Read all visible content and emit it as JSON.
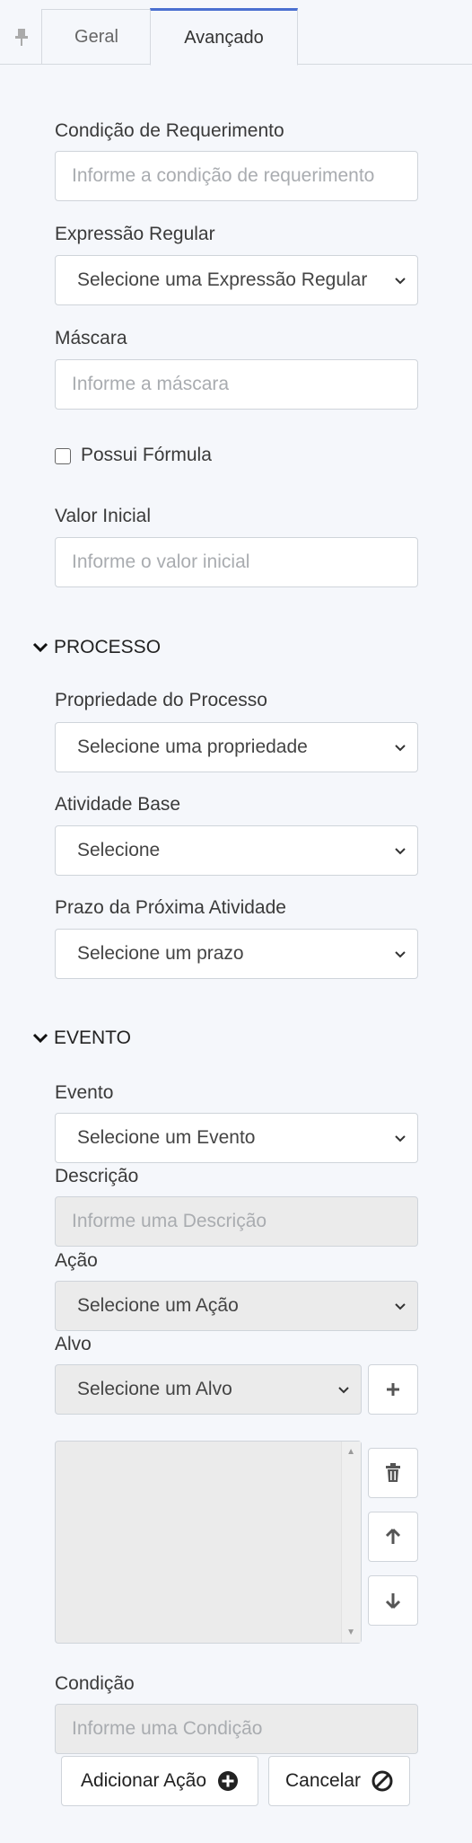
{
  "tabs": {
    "geral": "Geral",
    "avancado": "Avançado"
  },
  "fields": {
    "condicao_requerimento": {
      "label": "Condição de Requerimento",
      "placeholder": "Informe a condição de requerimento"
    },
    "expressao_regular": {
      "label": "Expressão Regular",
      "value": "Selecione uma Expressão Regular"
    },
    "mascara": {
      "label": "Máscara",
      "placeholder": "Informe a máscara"
    },
    "possui_formula": {
      "label": "Possui Fórmula",
      "checked": false
    },
    "valor_inicial": {
      "label": "Valor Inicial",
      "placeholder": "Informe o valor inicial"
    }
  },
  "processo": {
    "title": "PROCESSO",
    "propriedade": {
      "label": "Propriedade do Processo",
      "value": "Selecione uma propriedade"
    },
    "atividade_base": {
      "label": "Atividade Base",
      "value": "Selecione"
    },
    "prazo": {
      "label": "Prazo da Próxima Atividade",
      "value": "Selecione um prazo"
    }
  },
  "evento": {
    "title": "EVENTO",
    "evento": {
      "label": "Evento",
      "value": "Selecione um Evento"
    },
    "descricao": {
      "label": "Descrição",
      "placeholder": "Informe uma Descrição"
    },
    "acao": {
      "label": "Ação",
      "value": "Selecione um Ação"
    },
    "alvo": {
      "label": "Alvo",
      "value": "Selecione um Alvo"
    },
    "condicao": {
      "label": "Condição",
      "placeholder": "Informe uma Condição"
    }
  },
  "buttons": {
    "adicionar_acao": "Adicionar Ação",
    "cancelar": "Cancelar"
  },
  "icons": [
    "pin-icon",
    "chevron-down-icon",
    "plus-icon",
    "trash-icon",
    "arrow-up-icon",
    "arrow-down-icon",
    "plus-circle-icon",
    "ban-icon"
  ],
  "colors": {
    "accent": "#4a6fd0",
    "background": "#f5f7fb",
    "disabled": "#ebebeb"
  }
}
